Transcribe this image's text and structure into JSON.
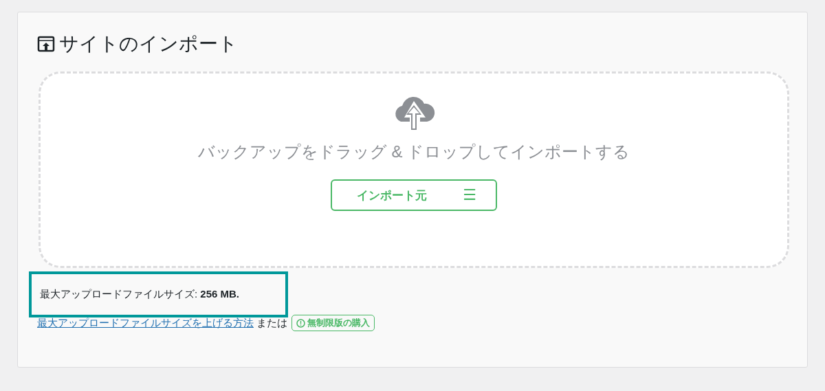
{
  "panel": {
    "title": "サイトのインポート"
  },
  "dropzone": {
    "message": "バックアップをドラッグ & ドロップしてインポートする",
    "button": {
      "label": "インポート元",
      "icon": "☰"
    }
  },
  "max_size": {
    "text": "最大アップロードファイルサイズ: **256 MB.**",
    "highlighted": true
  },
  "help": {
    "link": "最大アップロードファイルサイズを上げる方法",
    "separator": "または",
    "badge": "無制限版の購入"
  }
}
